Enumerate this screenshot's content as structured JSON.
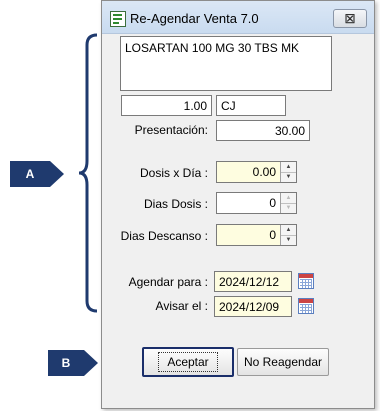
{
  "window": {
    "title": "Re-Agendar Venta 7.0",
    "close_symbol": "☒"
  },
  "product": {
    "description": "LOSARTAN 100 MG 30 TBS MK"
  },
  "quantity": {
    "value": "1.00",
    "unit": "CJ"
  },
  "presentacion": {
    "label": "Presentación:",
    "value": "30.00"
  },
  "dosis_x_dia": {
    "label": "Dosis x Día :",
    "value": "0.00"
  },
  "dias_dosis": {
    "label": "Dias Dosis :",
    "value": "0"
  },
  "dias_descanso": {
    "label": "Dias Descanso :",
    "value": "0"
  },
  "agendar_para": {
    "label": "Agendar para :",
    "value": "2024/12/12"
  },
  "avisar_el": {
    "label": "Avisar el :",
    "value": "2024/12/09"
  },
  "buttons": {
    "accept": "Aceptar",
    "no_reschedule": "No Reagendar"
  },
  "callouts": {
    "a": "A",
    "b": "B"
  },
  "colors": {
    "callout": "#1f3a6e",
    "highlight_field": "#fefde0"
  }
}
